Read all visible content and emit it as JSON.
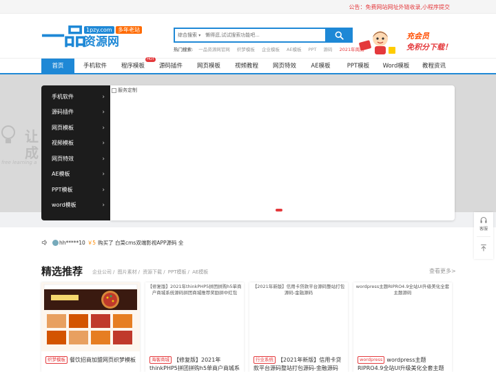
{
  "topbar": {
    "notice": "公告：免费网站网址外链收录,小程序提交"
  },
  "logo": {
    "mark": "一品",
    "domain": "1pzy.com",
    "tag": "多年老站",
    "name": "资源网"
  },
  "search": {
    "category": "综合搜索",
    "placeholder": "懒得逛,试试搜索功能吧...",
    "icon": "search-icon"
  },
  "hot": {
    "label": "热门搜索:",
    "keywords": [
      "一品资源网官网",
      "织梦模板",
      "企业模板",
      "AE模板",
      "PPT",
      "源码"
    ],
    "highlight": "2021年周历"
  },
  "promo": {
    "line1": "充会员",
    "line2": "免积分下载！"
  },
  "nav": {
    "items": [
      {
        "label": "首页"
      },
      {
        "label": "手机软件"
      },
      {
        "label": "程序模板",
        "badge": "HOT"
      },
      {
        "label": "源码插件"
      },
      {
        "label": "网页模板"
      },
      {
        "label": "视频教程"
      },
      {
        "label": "网页特效"
      },
      {
        "label": "AE模板"
      },
      {
        "label": "PPT模板"
      },
      {
        "label": "Word模板"
      },
      {
        "label": "教程资讯"
      }
    ]
  },
  "hero": {
    "bg_line1": "让",
    "bg_line2": "成",
    "bg_line3": "free learning a"
  },
  "catmenu": {
    "items": [
      "手机软件",
      "源码插件",
      "网页模板",
      "视频模板",
      "网页特效",
      "AE模板",
      "PPT模板",
      "word模板"
    ]
  },
  "slider": {
    "alt": "服务定制"
  },
  "sidefloat": {
    "service": "客服"
  },
  "ticker": {
    "user": "hh*****10",
    "price": "￥5",
    "text": "购买了 白菜cms双端影视APP源码 全"
  },
  "recommend": {
    "title": "精选推荐",
    "links": [
      "企业公司",
      "图片素材",
      "资源下载",
      "PPT模板",
      "AE模板"
    ],
    "more": "查看更多>",
    "cards": [
      {
        "alt": "",
        "cat": "织梦模板",
        "title": "餐饮招商加盟网页织梦模板"
      },
      {
        "alt": "【修复版】2021年thinkPHP5拼团拼购h5单商户商城系统源码拼团商城推荐奖励拼中红包",
        "cat": "海客商城",
        "title": "【修复版】2021年thinkPHP5拼团拼购h5单商户商城系"
      },
      {
        "alt": "【2021年新版】信用卡贷款平台源码整站打包源码-金融源码",
        "cat": "行业系统",
        "title": "【2021年新版】信用卡贷款平台源码整站打包源码-金融源码"
      },
      {
        "alt": "wordpress主题RIPRO4.9全站UI升级美化全套主题源码",
        "cat": "wordpress",
        "title": "wordpress主题RIPRO4.9全站UI升级美化全套主题源码"
      }
    ]
  },
  "colors": {
    "primary": "#1e88d6",
    "accent": "#e4393c",
    "orange": "#ff6a00"
  }
}
